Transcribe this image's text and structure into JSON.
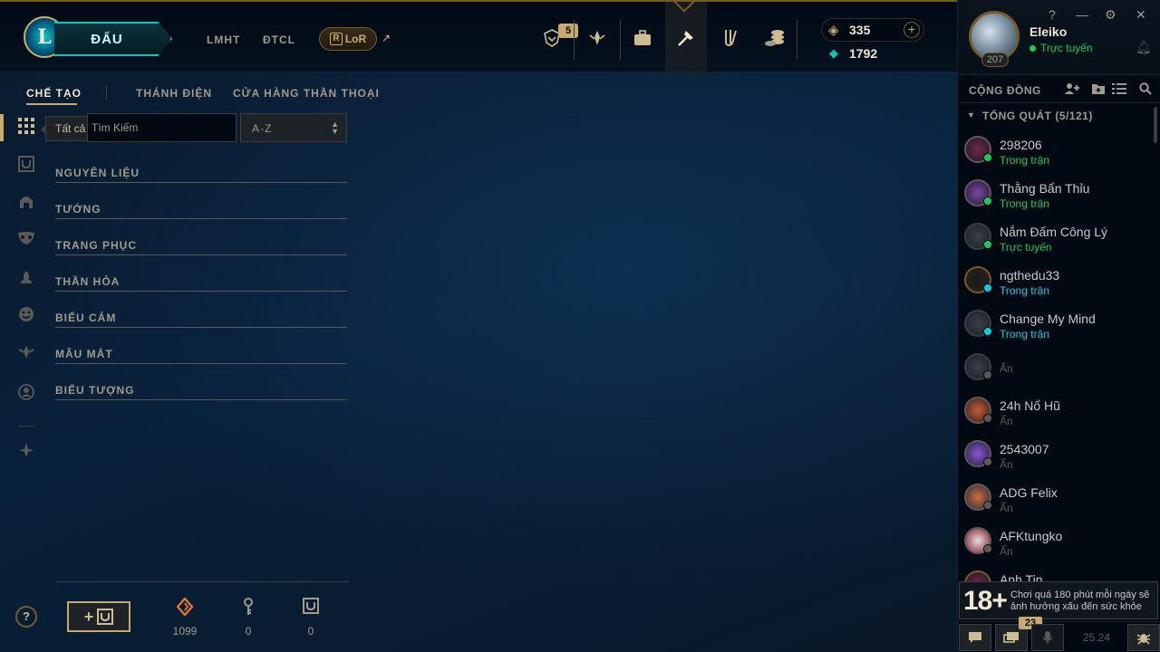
{
  "topbar": {
    "play_label": "ĐẤU",
    "nav": [
      "LMHT",
      "ĐTCL"
    ],
    "lor_label": "LoR",
    "notif_count": "5",
    "currency": {
      "rp": "335",
      "blue_essence": "1792"
    }
  },
  "profile": {
    "name": "Eleiko",
    "status": "Trực tuyến",
    "level": "207"
  },
  "social": {
    "label": "CỘNG ĐỒNG",
    "group_label": "TỔNG QUÁT (5/121)",
    "friends": [
      {
        "name": "298206",
        "status": "Trong trận",
        "color": "#1ec95b"
      },
      {
        "name": "Thằng Bẩn Thỉu",
        "status": "Trong trận",
        "color": "#1ec95b"
      },
      {
        "name": "Nắm Đấm Công Lý",
        "status": "Trực tuyến",
        "color": "#1ec95b"
      },
      {
        "name": "ngthedu33",
        "status": "Trong trận",
        "color": "#0acbe6"
      },
      {
        "name": "Change My Mind",
        "status": "Trong trận",
        "color": "#0acbe6"
      },
      {
        "name": "",
        "status": "Ẩn",
        "color": "#5b5a56"
      },
      {
        "name": "24h Nổ Hũ",
        "status": "Ẩn",
        "color": "#5b5a56"
      },
      {
        "name": "2543007",
        "status": "Ẩn",
        "color": "#5b5a56"
      },
      {
        "name": "ADG Felix",
        "status": "Ẩn",
        "color": "#5b5a56"
      },
      {
        "name": "AFKtungko",
        "status": "Ẩn",
        "color": "#5b5a56"
      },
      {
        "name": "Anh Tin",
        "status": "",
        "color": "#5b5a56"
      }
    ],
    "warning_rating": "18+",
    "warning_text": "Chơi quá 180 phút mỗi ngày sẽ ảnh hưởng xấu đến sức khỏe",
    "chat_badge": "23",
    "version": "25.24"
  },
  "subnav": {
    "tabs": [
      "CHẾ TẠO",
      "THÁNH ĐIỆN",
      "CỬA HÀNG THẦN THOẠI"
    ]
  },
  "filter": {
    "tooltip": "Tất cả",
    "search_placeholder": "Tìm Kiếm",
    "sort_value": "A-Z"
  },
  "categories": [
    "NGUYÊN LIỆU",
    "TƯỚNG",
    "TRANG PHỤC",
    "THẦN HỎA",
    "BIỂU CẢM",
    "MẪU MẮT",
    "BIỂU TƯỢNG"
  ],
  "inventory": {
    "essence": "1099",
    "keys": "0",
    "chests": "0"
  }
}
